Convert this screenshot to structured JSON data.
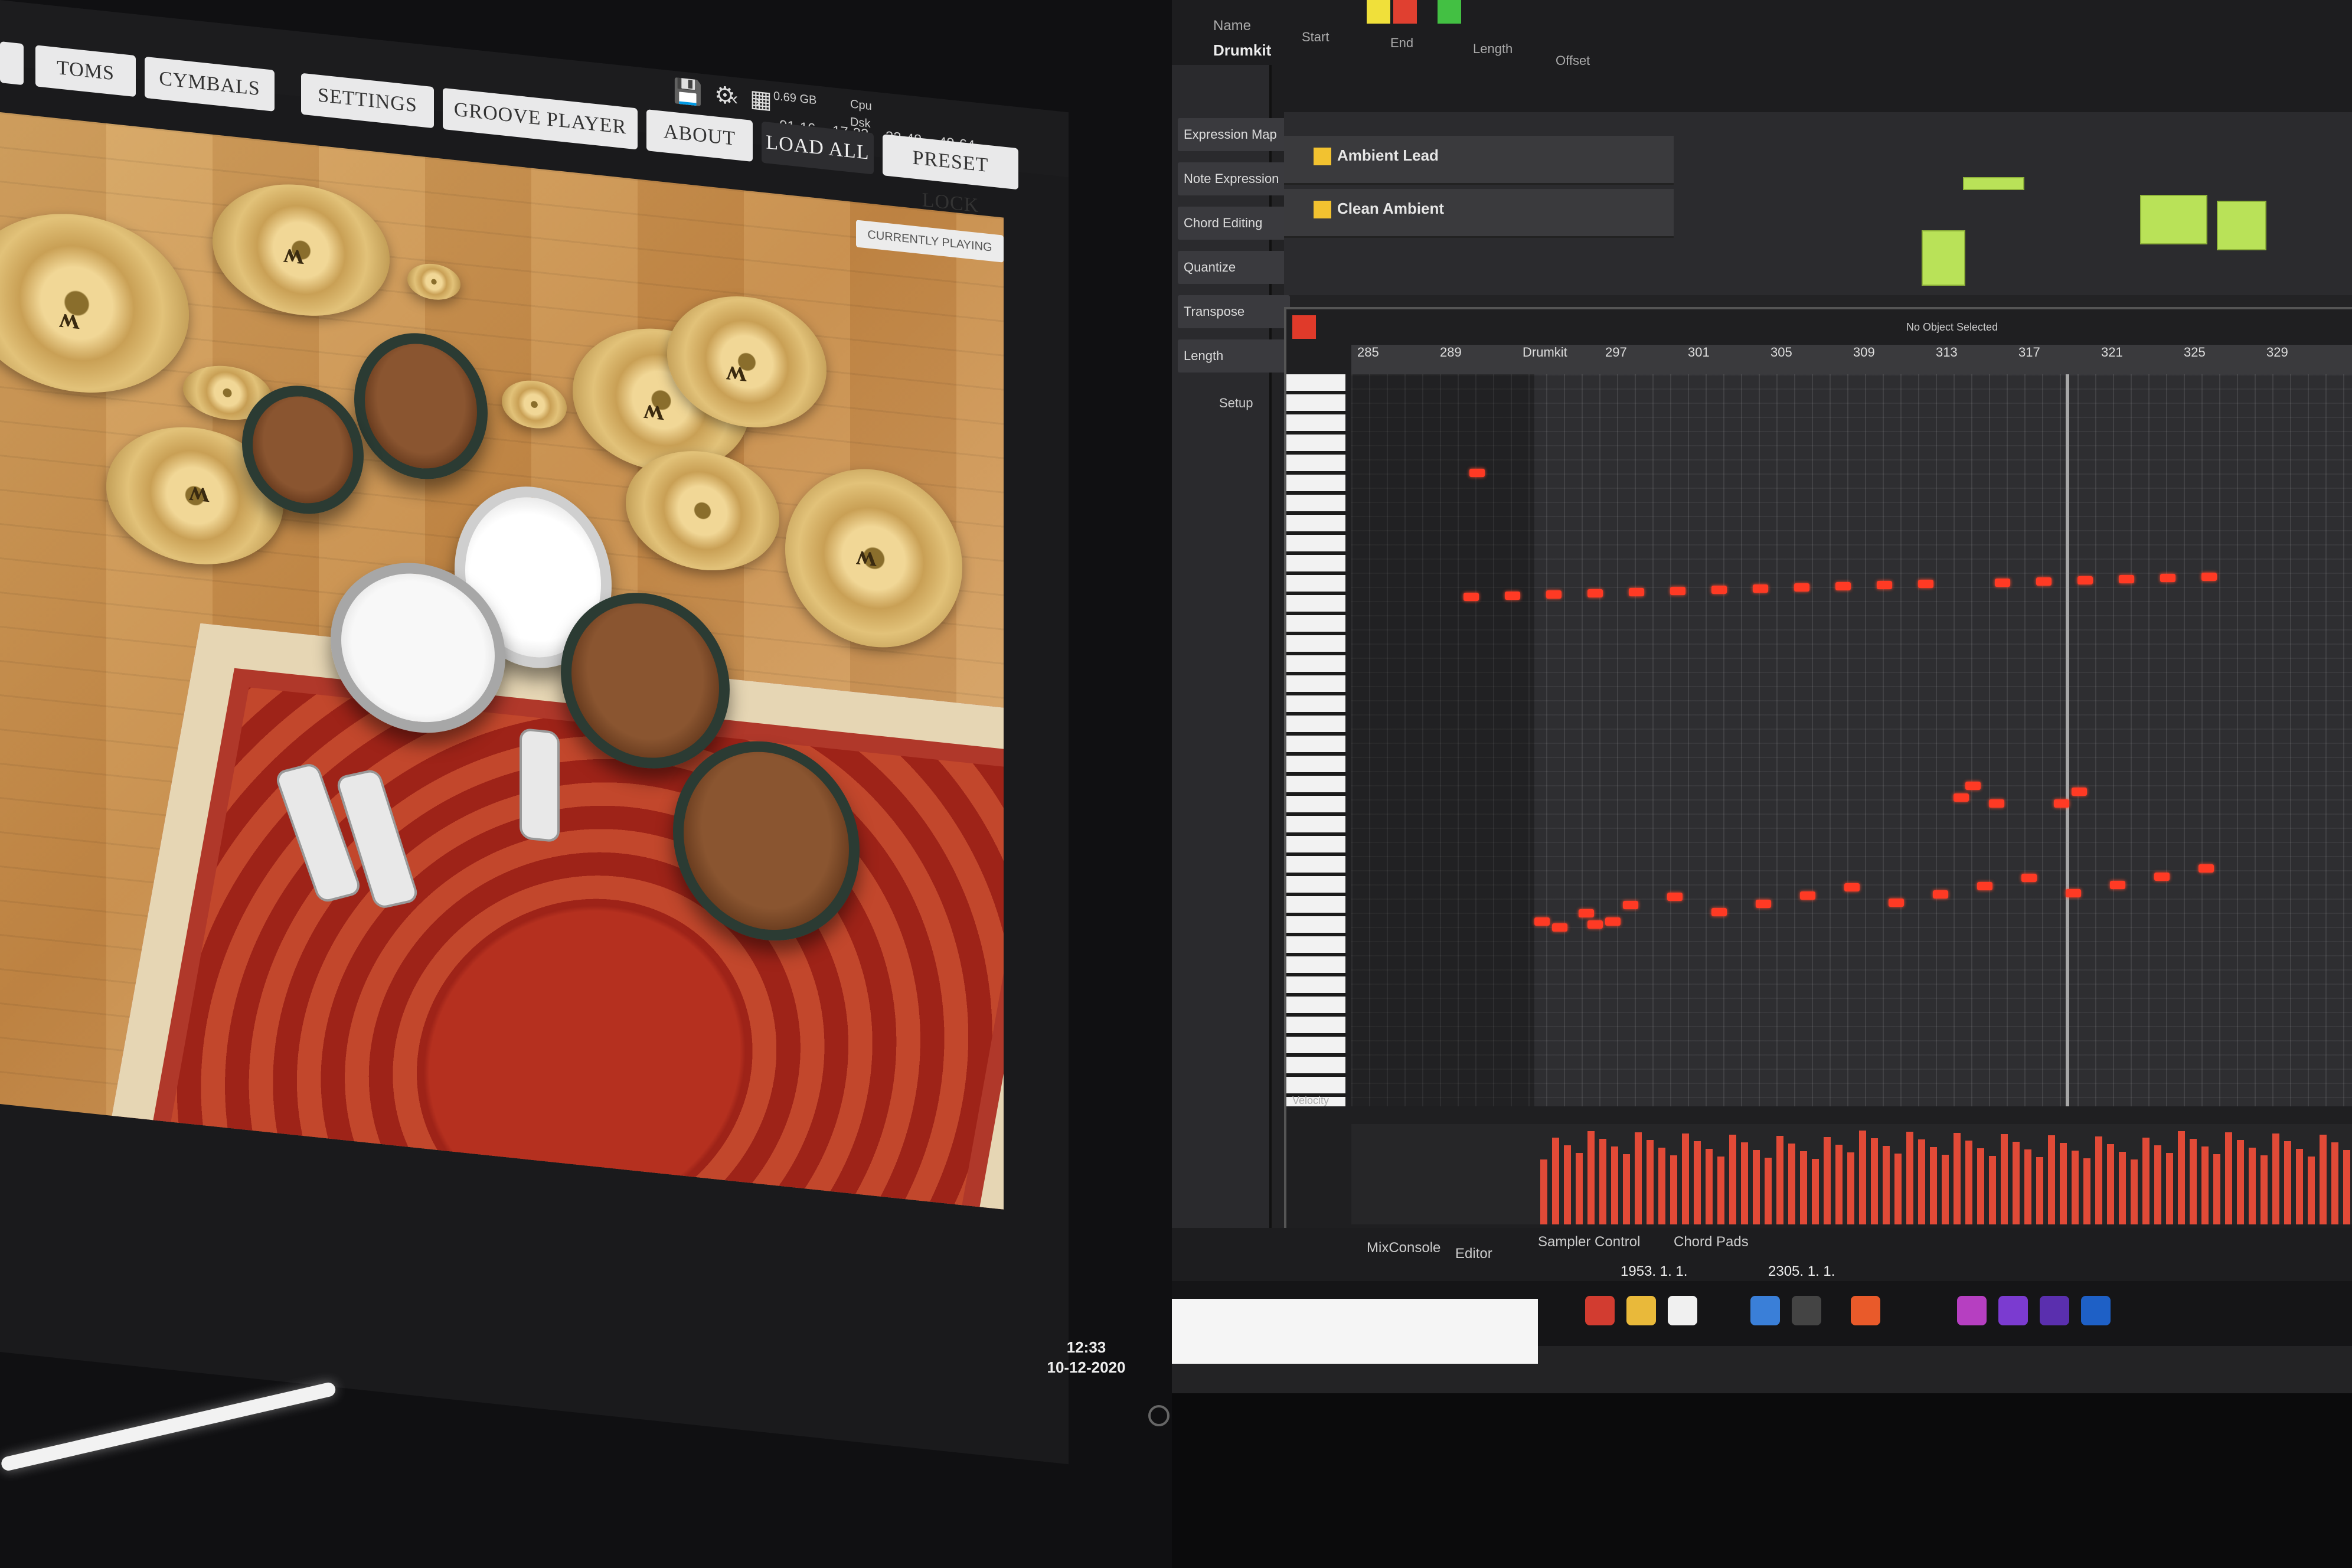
{
  "left_app": {
    "tabs": [
      "TOMS",
      "CYMBALS",
      "SETTINGS",
      "GROOVE PLAYER",
      "ABOUT"
    ],
    "buttons": {
      "load_all": "LOAD ALL",
      "preset_lock": "PRESET LOCK"
    },
    "pager": [
      "01-16",
      "17-32",
      "33-48",
      "49-64"
    ],
    "status": {
      "playing": "CURRENTLY PLAYING",
      "disk": "0.69 GB",
      "cpu": "Cpu",
      "dsk": "Dsk"
    },
    "cymbal_logo": "ʍ"
  },
  "clock": {
    "time": "12:33",
    "date": "10-12-2020"
  },
  "right_app": {
    "toolbar": {
      "name_label": "Name",
      "name_value": "Drumkit",
      "start": "Start",
      "end": "End",
      "length": "Length",
      "offset": "Offset"
    },
    "inspector": [
      "Expression Map",
      "Note Expression",
      "Chord Editing",
      "Quantize",
      "Transpose",
      "Length"
    ],
    "setup": "Setup",
    "tracks": [
      "Ambient Lead",
      "Clean Ambient"
    ],
    "editor_title": "No Object Selected",
    "velocity_label": "Velocity",
    "bottom_tabs": [
      "MixConsole",
      "Editor",
      "Sampler Control",
      "Chord Pads"
    ],
    "positions": [
      "1953. 1. 1.",
      "2305. 1. 1."
    ],
    "ruler_ticks": [
      "285",
      "289",
      "Drumkit",
      "297",
      "301",
      "305",
      "309",
      "313",
      "317",
      "321",
      "325",
      "329"
    ]
  },
  "colors": {
    "note": "#ff3a24",
    "track_green": "#b9e258"
  }
}
